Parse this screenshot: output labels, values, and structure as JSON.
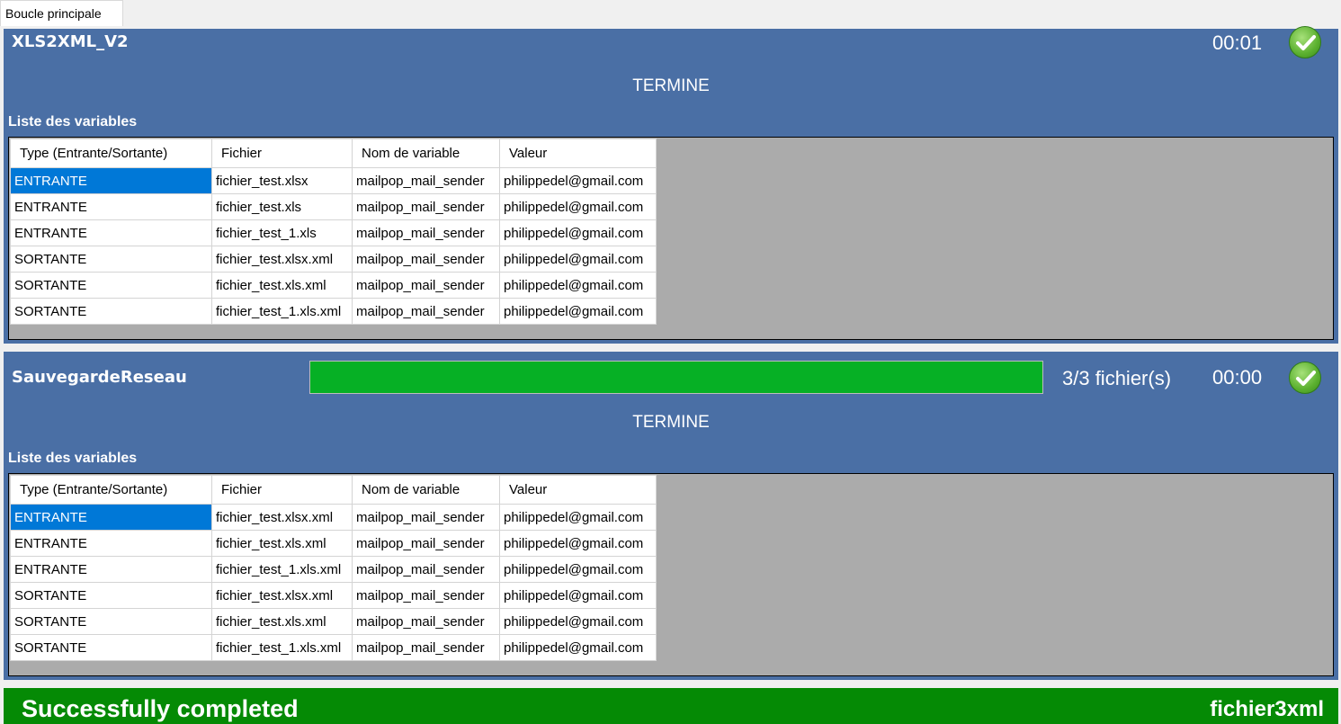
{
  "tab": {
    "label": "Boucle principale"
  },
  "steps": [
    {
      "name": "XLS2XML_V2",
      "time": "00:01",
      "status": "TERMINE",
      "vars_label": "Liste des variables",
      "columns": [
        "Type (Entrante/Sortante)",
        "Fichier",
        "Nom de variable",
        "Valeur"
      ],
      "rows": [
        [
          "ENTRANTE",
          "fichier_test.xlsx",
          "mailpop_mail_sender",
          "philippedel@gmail.com"
        ],
        [
          "ENTRANTE",
          "fichier_test.xls",
          "mailpop_mail_sender",
          "philippedel@gmail.com"
        ],
        [
          "ENTRANTE",
          "fichier_test_1.xls",
          "mailpop_mail_sender",
          "philippedel@gmail.com"
        ],
        [
          "SORTANTE",
          "fichier_test.xlsx.xml",
          "mailpop_mail_sender",
          "philippedel@gmail.com"
        ],
        [
          "SORTANTE",
          "fichier_test.xls.xml",
          "mailpop_mail_sender",
          "philippedel@gmail.com"
        ],
        [
          "SORTANTE",
          "fichier_test_1.xls.xml",
          "mailpop_mail_sender",
          "philippedel@gmail.com"
        ]
      ]
    },
    {
      "name": "SauvegardeReseau",
      "progress": 1.0,
      "files": "3/3 fichier(s)",
      "time": "00:00",
      "status": "TERMINE",
      "vars_label": "Liste des variables",
      "columns": [
        "Type (Entrante/Sortante)",
        "Fichier",
        "Nom de variable",
        "Valeur"
      ],
      "rows": [
        [
          "ENTRANTE",
          "fichier_test.xlsx.xml",
          "mailpop_mail_sender",
          "philippedel@gmail.com"
        ],
        [
          "ENTRANTE",
          "fichier_test.xls.xml",
          "mailpop_mail_sender",
          "philippedel@gmail.com"
        ],
        [
          "ENTRANTE",
          "fichier_test_1.xls.xml",
          "mailpop_mail_sender",
          "philippedel@gmail.com"
        ],
        [
          "SORTANTE",
          "fichier_test.xlsx.xml",
          "mailpop_mail_sender",
          "philippedel@gmail.com"
        ],
        [
          "SORTANTE",
          "fichier_test.xls.xml",
          "mailpop_mail_sender",
          "philippedel@gmail.com"
        ],
        [
          "SORTANTE",
          "fichier_test_1.xls.xml",
          "mailpop_mail_sender",
          "philippedel@gmail.com"
        ]
      ]
    }
  ],
  "banner": {
    "message": "Successfully completed",
    "file": "fichier3xml"
  },
  "colors": {
    "panel": "#4a6fa5",
    "progress": "#06b025",
    "banner": "#058a05",
    "selection": "#0078d7"
  },
  "icons": {
    "status": "check-circle-icon"
  }
}
